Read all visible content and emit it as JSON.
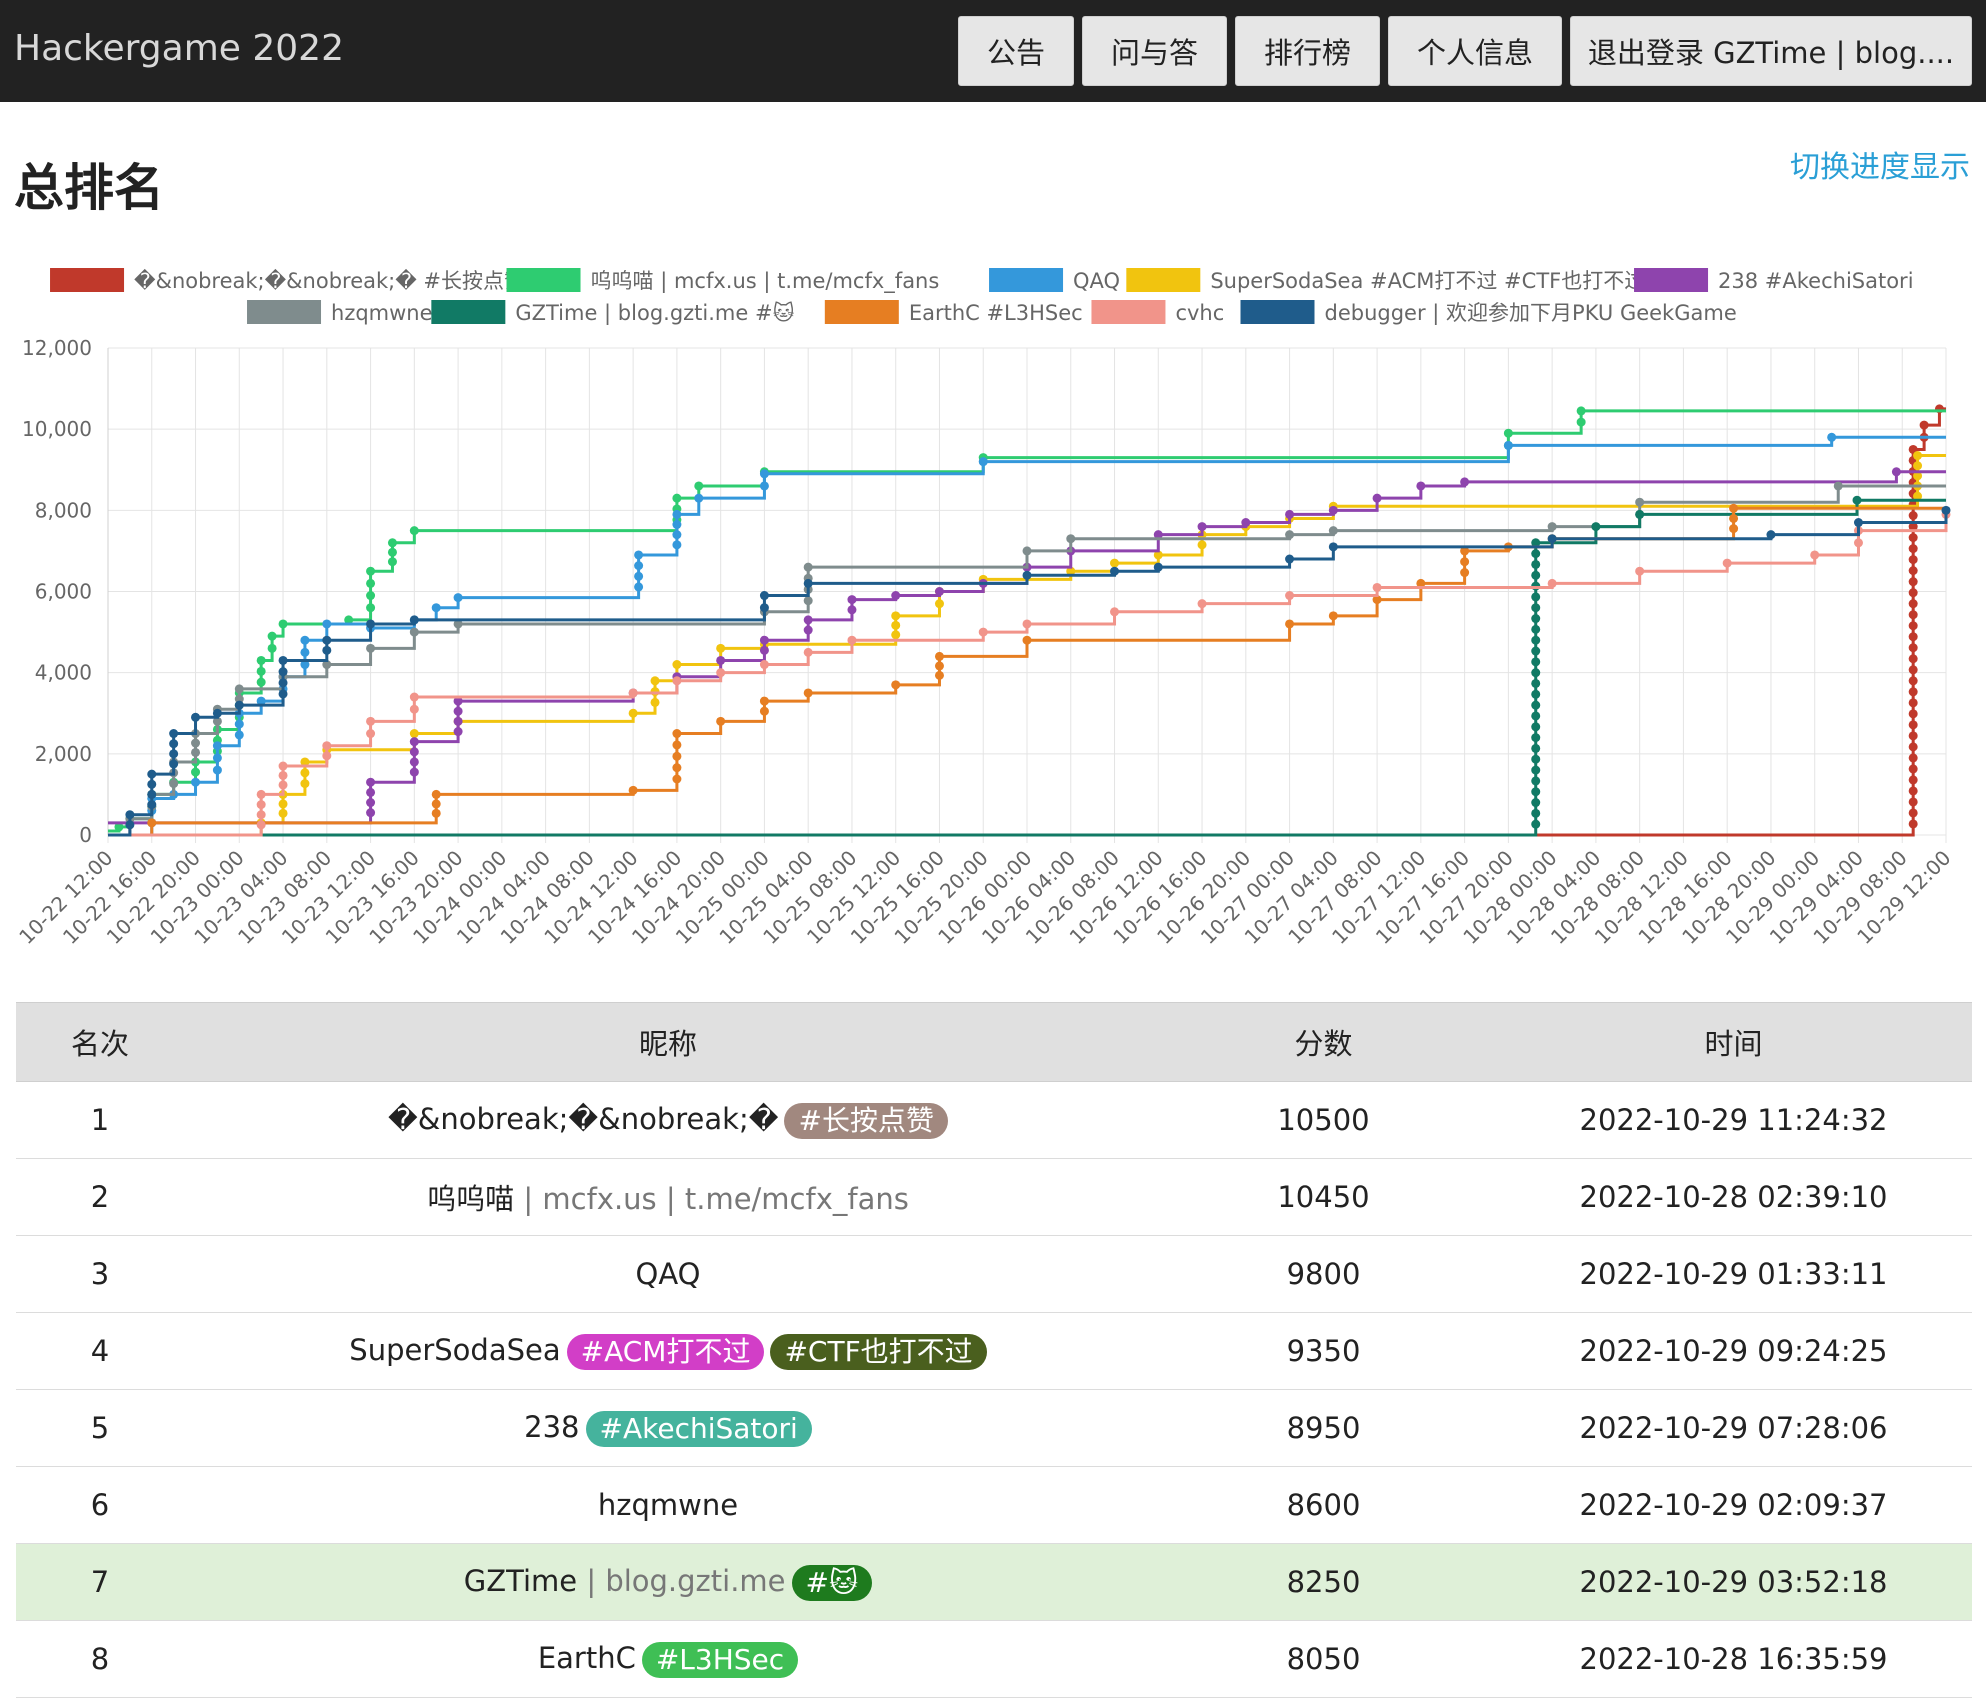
{
  "nav": {
    "brand": "Hackergame 2022",
    "buttons": [
      "公告",
      "问与答",
      "排行榜",
      "个人信息",
      "退出登录 GZTime | blog...."
    ]
  },
  "page": {
    "title": "总排名",
    "toggle_label": "切换进度显示"
  },
  "chart_data": {
    "type": "line",
    "step": true,
    "xlabel": "",
    "ylabel": "",
    "ylim": [
      0,
      12000
    ],
    "y_ticks": [
      0,
      2000,
      4000,
      6000,
      8000,
      10000,
      12000
    ],
    "y_tick_labels": [
      "0",
      "2,000",
      "4,000",
      "6,000",
      "8,000",
      "10,000",
      "12,000"
    ],
    "x_range": [
      "10-22 12:00",
      "10-29 12:00"
    ],
    "x_tick_labels": [
      "10-22 12:00",
      "10-22 16:00",
      "10-22 20:00",
      "10-23 00:00",
      "10-23 04:00",
      "10-23 08:00",
      "10-23 12:00",
      "10-23 16:00",
      "10-23 20:00",
      "10-24 00:00",
      "10-24 04:00",
      "10-24 08:00",
      "10-24 12:00",
      "10-24 16:00",
      "10-24 20:00",
      "10-25 00:00",
      "10-25 04:00",
      "10-25 08:00",
      "10-25 12:00",
      "10-25 16:00",
      "10-25 20:00",
      "10-26 00:00",
      "10-26 04:00",
      "10-26 08:00",
      "10-26 12:00",
      "10-26 16:00",
      "10-26 20:00",
      "10-27 00:00",
      "10-27 04:00",
      "10-27 08:00",
      "10-27 12:00",
      "10-27 16:00",
      "10-27 20:00",
      "10-28 00:00",
      "10-28 04:00",
      "10-28 08:00",
      "10-28 12:00",
      "10-28 16:00",
      "10-28 20:00",
      "10-29 00:00",
      "10-29 04:00",
      "10-29 08:00",
      "10-29 12:00"
    ],
    "grid": true,
    "legend_position": "top",
    "series": [
      {
        "name": "�&nobreak;�&nobreak;� #长按点赞",
        "color": "#c0392b",
        "x": [
          "10-22 12:00",
          "10-29 08:10",
          "10-29 09:00",
          "10-29 10:00",
          "10-29 11:24",
          "10-29 12:00"
        ],
        "y": [
          0,
          0,
          9500,
          10100,
          10500,
          10500
        ]
      },
      {
        "name": "呜呜喵 | mcfx.us | t.me/mcfx_fans",
        "color": "#2ecc71",
        "x": [
          "10-22 12:00",
          "10-22 13:00",
          "10-22 14:00",
          "10-22 16:00",
          "10-22 18:00",
          "10-22 20:00",
          "10-22 22:00",
          "10-23 00:00",
          "10-23 02:00",
          "10-23 03:00",
          "10-23 04:00",
          "10-23 06:00",
          "10-23 10:00",
          "10-23 12:00",
          "10-23 14:00",
          "10-23 16:00",
          "10-24 12:00",
          "10-24 16:00",
          "10-24 18:00",
          "10-25 00:00",
          "10-25 20:00",
          "10-27 20:00",
          "10-28 02:39",
          "10-29 12:00"
        ],
        "y": [
          100,
          200,
          400,
          1000,
          1300,
          1800,
          2600,
          3500,
          4300,
          4900,
          5200,
          5200,
          5300,
          6500,
          7200,
          7500,
          7500,
          8300,
          8600,
          8950,
          9300,
          9900,
          10450,
          10450
        ]
      },
      {
        "name": "QAQ",
        "color": "#3498db",
        "x": [
          "10-22 12:00",
          "10-22 14:00",
          "10-22 16:00",
          "10-22 18:00",
          "10-22 20:00",
          "10-22 22:00",
          "10-23 00:00",
          "10-23 02:00",
          "10-23 04:00",
          "10-23 06:00",
          "10-23 08:00",
          "10-23 12:00",
          "10-23 16:00",
          "10-23 18:00",
          "10-23 20:00",
          "10-24 12:00",
          "10-24 12:30",
          "10-24 16:00",
          "10-24 18:00",
          "10-25 00:00",
          "10-25 20:00",
          "10-27 20:00",
          "10-29 01:33",
          "10-29 12:00"
        ],
        "y": [
          0,
          0,
          900,
          1000,
          1300,
          2200,
          3000,
          3300,
          3900,
          4800,
          5200,
          5100,
          5300,
          5600,
          5850,
          5850,
          6900,
          7900,
          8300,
          8900,
          9200,
          9600,
          9800,
          9800
        ]
      },
      {
        "name": "SuperSodaSea #ACM打不过 #CTF也打不过",
        "color": "#f1c40f",
        "x": [
          "10-22 12:00",
          "10-23 00:00",
          "10-23 02:00",
          "10-23 04:00",
          "10-23 06:00",
          "10-23 08:00",
          "10-23 16:00",
          "10-23 20:00",
          "10-24 12:00",
          "10-24 14:00",
          "10-24 16:00",
          "10-24 20:00",
          "10-25 00:00",
          "10-25 12:00",
          "10-25 16:00",
          "10-25 20:00",
          "10-26 04:00",
          "10-26 08:00",
          "10-26 12:00",
          "10-26 16:00",
          "10-26 20:00",
          "10-27 00:00",
          "10-27 04:00",
          "10-29 09:24",
          "10-29 12:00"
        ],
        "y": [
          0,
          0,
          300,
          1000,
          1800,
          2100,
          2500,
          2800,
          3000,
          3800,
          4200,
          4600,
          4700,
          5400,
          6000,
          6300,
          6500,
          6700,
          6900,
          7400,
          7600,
          7800,
          8100,
          9350,
          9350
        ]
      },
      {
        "name": "238 #AkechiSatori",
        "color": "#8e44ad",
        "x": [
          "10-22 12:00",
          "10-23 08:00",
          "10-23 12:00",
          "10-23 16:00",
          "10-23 20:00",
          "10-24 12:00",
          "10-24 16:00",
          "10-24 20:00",
          "10-25 00:00",
          "10-25 04:00",
          "10-25 08:00",
          "10-25 12:00",
          "10-25 16:00",
          "10-25 20:00",
          "10-26 00:00",
          "10-26 04:00",
          "10-26 12:00",
          "10-26 16:00",
          "10-26 20:00",
          "10-27 00:00",
          "10-27 04:00",
          "10-27 08:00",
          "10-27 12:00",
          "10-27 16:00",
          "10-29 07:28",
          "10-29 12:00"
        ],
        "y": [
          300,
          300,
          1300,
          2300,
          3300,
          3500,
          3900,
          4300,
          4800,
          5300,
          5800,
          5900,
          6000,
          6200,
          6600,
          7000,
          7400,
          7600,
          7700,
          7900,
          8000,
          8300,
          8600,
          8700,
          8950,
          8950
        ]
      },
      {
        "name": "hzqmwne",
        "color": "#7f8c8d",
        "x": [
          "10-22 12:00",
          "10-22 14:00",
          "10-22 16:00",
          "10-22 18:00",
          "10-22 20:00",
          "10-22 22:00",
          "10-23 00:00",
          "10-23 04:00",
          "10-23 08:00",
          "10-23 12:00",
          "10-23 16:00",
          "10-23 20:00",
          "10-25 00:00",
          "10-25 04:00",
          "10-26 00:00",
          "10-26 04:00",
          "10-27 00:00",
          "10-27 04:00",
          "10-28 00:00",
          "10-28 08:00",
          "10-29 02:09",
          "10-29 12:00"
        ],
        "y": [
          0,
          400,
          1000,
          1800,
          2500,
          3100,
          3600,
          3900,
          4200,
          4600,
          5000,
          5200,
          5500,
          6600,
          7000,
          7300,
          7400,
          7500,
          7600,
          8200,
          8600,
          8600
        ]
      },
      {
        "name": "GZTime | blog.gzti.me #🐱",
        "color": "#117a65",
        "x": [
          "10-22 12:00",
          "10-27 22:00",
          "10-27 22:30",
          "10-28 04:00",
          "10-28 08:00",
          "10-29 03:52",
          "10-29 12:00"
        ],
        "y": [
          0,
          0,
          7200,
          7600,
          7900,
          8250,
          8250
        ]
      },
      {
        "name": "EarthC #L3HSec",
        "color": "#e67e22",
        "x": [
          "10-22 12:00",
          "10-22 16:00",
          "10-23 16:00",
          "10-23 18:00",
          "10-24 12:00",
          "10-24 16:00",
          "10-24 20:00",
          "10-25 00:00",
          "10-25 04:00",
          "10-25 12:00",
          "10-25 16:00",
          "10-26 00:00",
          "10-27 00:00",
          "10-27 04:00",
          "10-27 08:00",
          "10-27 12:00",
          "10-27 16:00",
          "10-27 20:00",
          "10-28 00:00",
          "10-28 16:35",
          "10-29 12:00"
        ],
        "y": [
          0,
          300,
          300,
          1000,
          1100,
          2500,
          2800,
          3300,
          3500,
          3700,
          4400,
          4800,
          5200,
          5400,
          5800,
          6200,
          7000,
          7100,
          7300,
          8050,
          8050
        ]
      },
      {
        "name": "cvhc",
        "color": "#f1948a",
        "x": [
          "10-22 12:00",
          "10-23 00:00",
          "10-23 02:00",
          "10-23 04:00",
          "10-23 08:00",
          "10-23 12:00",
          "10-23 16:00",
          "10-24 12:00",
          "10-24 16:00",
          "10-24 20:00",
          "10-25 00:00",
          "10-25 04:00",
          "10-25 08:00",
          "10-25 20:00",
          "10-26 00:00",
          "10-26 08:00",
          "10-26 16:00",
          "10-27 00:00",
          "10-27 08:00",
          "10-28 00:00",
          "10-28 08:00",
          "10-28 16:00",
          "10-29 00:00",
          "10-29 04:00",
          "10-29 12:00"
        ],
        "y": [
          0,
          0,
          1000,
          1700,
          2200,
          2800,
          3400,
          3500,
          3800,
          4000,
          4200,
          4500,
          4800,
          5000,
          5200,
          5500,
          5700,
          5900,
          6100,
          6200,
          6500,
          6700,
          6900,
          7500,
          7900
        ]
      },
      {
        "name": "debugger | 欢迎参加下月PKU GeekGame",
        "color": "#1f5c8b",
        "x": [
          "10-22 12:00",
          "10-22 14:00",
          "10-22 16:00",
          "10-22 18:00",
          "10-22 20:00",
          "10-22 22:00",
          "10-23 00:00",
          "10-23 04:00",
          "10-23 08:00",
          "10-23 12:00",
          "10-23 16:00",
          "10-25 00:00",
          "10-25 04:00",
          "10-26 00:00",
          "10-26 08:00",
          "10-26 12:00",
          "10-27 00:00",
          "10-27 04:00",
          "10-28 00:00",
          "10-28 08:00",
          "10-28 20:00",
          "10-29 04:00",
          "10-29 12:00"
        ],
        "y": [
          0,
          500,
          1500,
          2500,
          2900,
          3000,
          3200,
          4300,
          4800,
          5200,
          5300,
          5900,
          6200,
          6400,
          6500,
          6600,
          6800,
          7100,
          7300,
          7300,
          7400,
          7700,
          8000
        ]
      }
    ]
  },
  "table": {
    "headers": [
      "名次",
      "昵称",
      "分数",
      "时间"
    ],
    "rows": [
      {
        "rank": "1",
        "name": "�&nobreak;�&nobreak;�",
        "ext": "",
        "tags": [
          {
            "text": "#长按点赞",
            "color": "#a1887f"
          }
        ],
        "score": "10500",
        "time": "2022-10-29 11:24:32",
        "highlight": false
      },
      {
        "rank": "2",
        "name": "呜呜喵",
        "ext": " | mcfx.us | t.me/mcfx_fans",
        "tags": [],
        "score": "10450",
        "time": "2022-10-28 02:39:10",
        "highlight": false
      },
      {
        "rank": "3",
        "name": "QAQ",
        "ext": "",
        "tags": [],
        "score": "9800",
        "time": "2022-10-29 01:33:11",
        "highlight": false
      },
      {
        "rank": "4",
        "name": "SuperSodaSea",
        "ext": "",
        "tags": [
          {
            "text": "#ACM打不过",
            "color": "#d23ec7"
          },
          {
            "text": "#CTF也打不过",
            "color": "#4a5f1e"
          }
        ],
        "score": "9350",
        "time": "2022-10-29 09:24:25",
        "highlight": false
      },
      {
        "rank": "5",
        "name": "238",
        "ext": "",
        "tags": [
          {
            "text": "#AkechiSatori",
            "color": "#45b39d"
          }
        ],
        "score": "8950",
        "time": "2022-10-29 07:28:06",
        "highlight": false
      },
      {
        "rank": "6",
        "name": "hzqmwne",
        "ext": "",
        "tags": [],
        "score": "8600",
        "time": "2022-10-29 02:09:37",
        "highlight": false
      },
      {
        "rank": "7",
        "name": "GZTime",
        "ext": " | blog.gzti.me",
        "tags": [
          {
            "text": "#🐱",
            "color": "#1e7b1e"
          }
        ],
        "score": "8250",
        "time": "2022-10-29 03:52:18",
        "highlight": true
      },
      {
        "rank": "8",
        "name": "EarthC",
        "ext": "",
        "tags": [
          {
            "text": "#L3HSec",
            "color": "#3fbf55"
          }
        ],
        "score": "8050",
        "time": "2022-10-28 16:35:59",
        "highlight": false
      }
    ]
  }
}
